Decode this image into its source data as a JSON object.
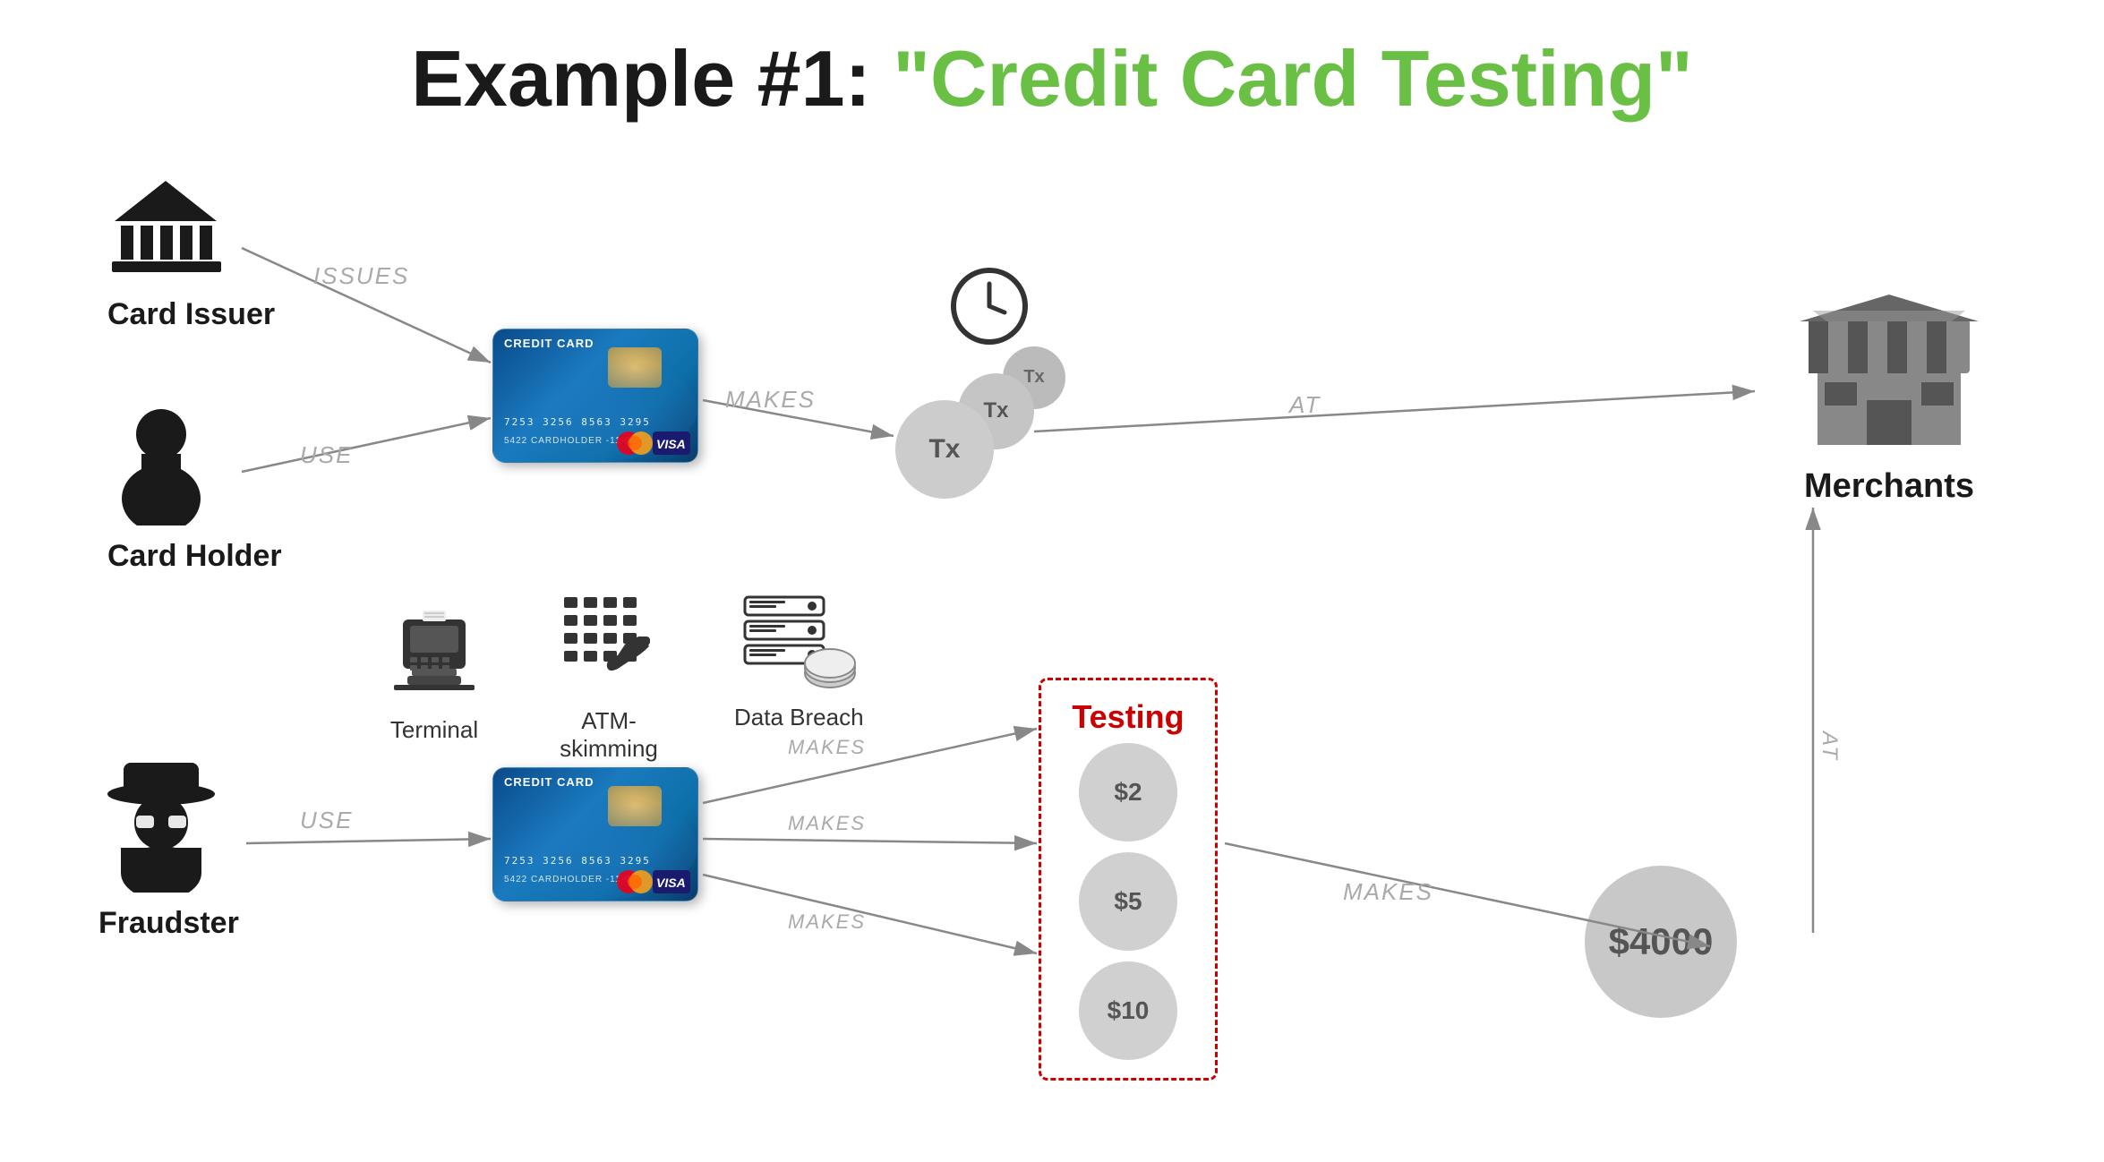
{
  "title": {
    "prefix": "Example #1:",
    "highlighted": "\"Credit Card Testing\""
  },
  "actors": {
    "card_issuer": {
      "label": "Card Issuer"
    },
    "card_holder": {
      "label": "Card Holder"
    },
    "fraudster": {
      "label": "Fraudster"
    },
    "merchants": {
      "label": "Merchants"
    }
  },
  "arrows": {
    "issues": "ISSUES",
    "use_top": "USE",
    "use_bottom": "USE",
    "makes_top": "MAKES",
    "at_top": "AT",
    "makes_bottom1": "MAKES",
    "makes_bottom2": "MAKES",
    "makes_bottom3": "MAKES",
    "makes_large": "MAKES",
    "at_bottom": "AT"
  },
  "transactions": {
    "tx_large": "Tx",
    "tx_medium": "Tx",
    "tx_small": "Tx"
  },
  "testing": {
    "label": "Testing",
    "amounts": [
      "$2",
      "$5",
      "$10"
    ],
    "large_amount": "$4000"
  },
  "icons": {
    "terminal_label": "Terminal",
    "atm_label": "ATM-\nskimming",
    "databreach_label": "Data Breach"
  }
}
